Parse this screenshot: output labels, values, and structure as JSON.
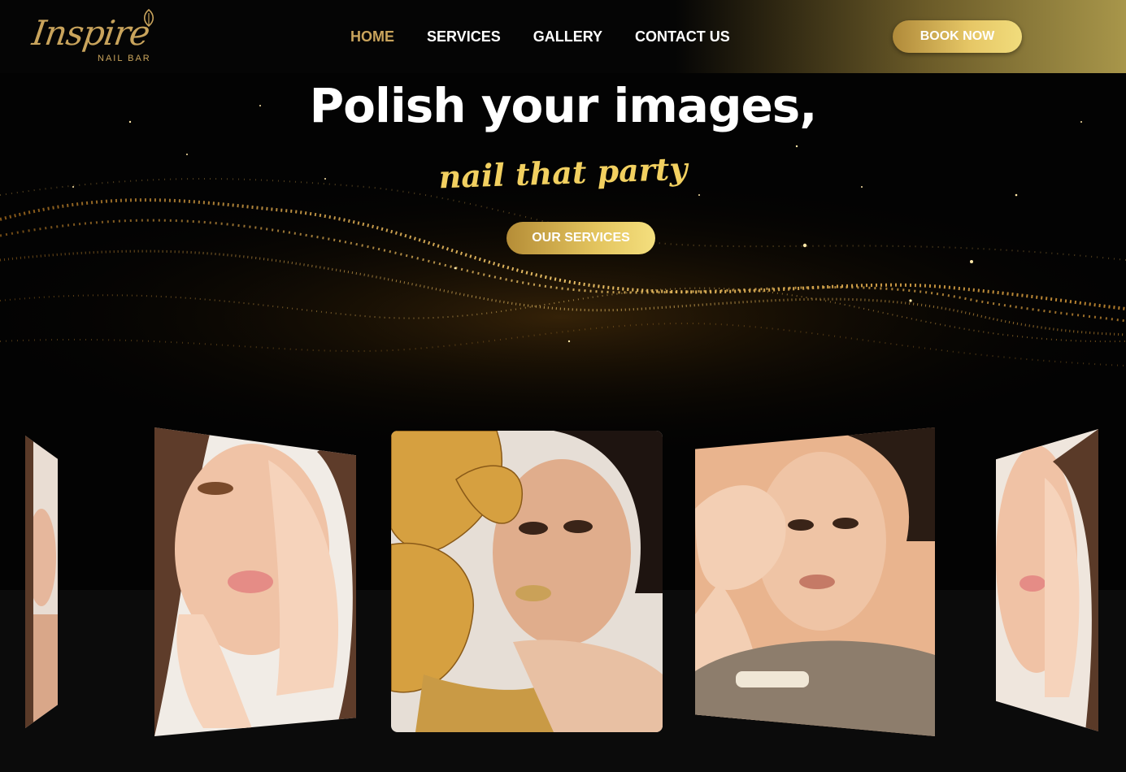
{
  "brand": {
    "name": "Inspire",
    "tagline": "NAIL BAR",
    "color": "#c9a45c"
  },
  "nav": {
    "items": [
      {
        "label": "HOME",
        "active": true
      },
      {
        "label": "SERVICES",
        "active": false
      },
      {
        "label": "GALLERY",
        "active": false
      },
      {
        "label": "CONTACT US",
        "active": false
      }
    ],
    "book_label": "BOOK NOW"
  },
  "hero": {
    "title": "Polish your images,",
    "subtitle": "nail that party",
    "cta_label": "OUR SERVICES",
    "accent": "#f2d060"
  },
  "gallery": {
    "cards": [
      {
        "icon": "woman-portrait-photo"
      },
      {
        "icon": "woman-portrait-photo"
      },
      {
        "icon": "woman-gold-flowers-photo"
      },
      {
        "icon": "woman-gold-nails-photo"
      },
      {
        "icon": "woman-portrait-photo"
      }
    ]
  }
}
